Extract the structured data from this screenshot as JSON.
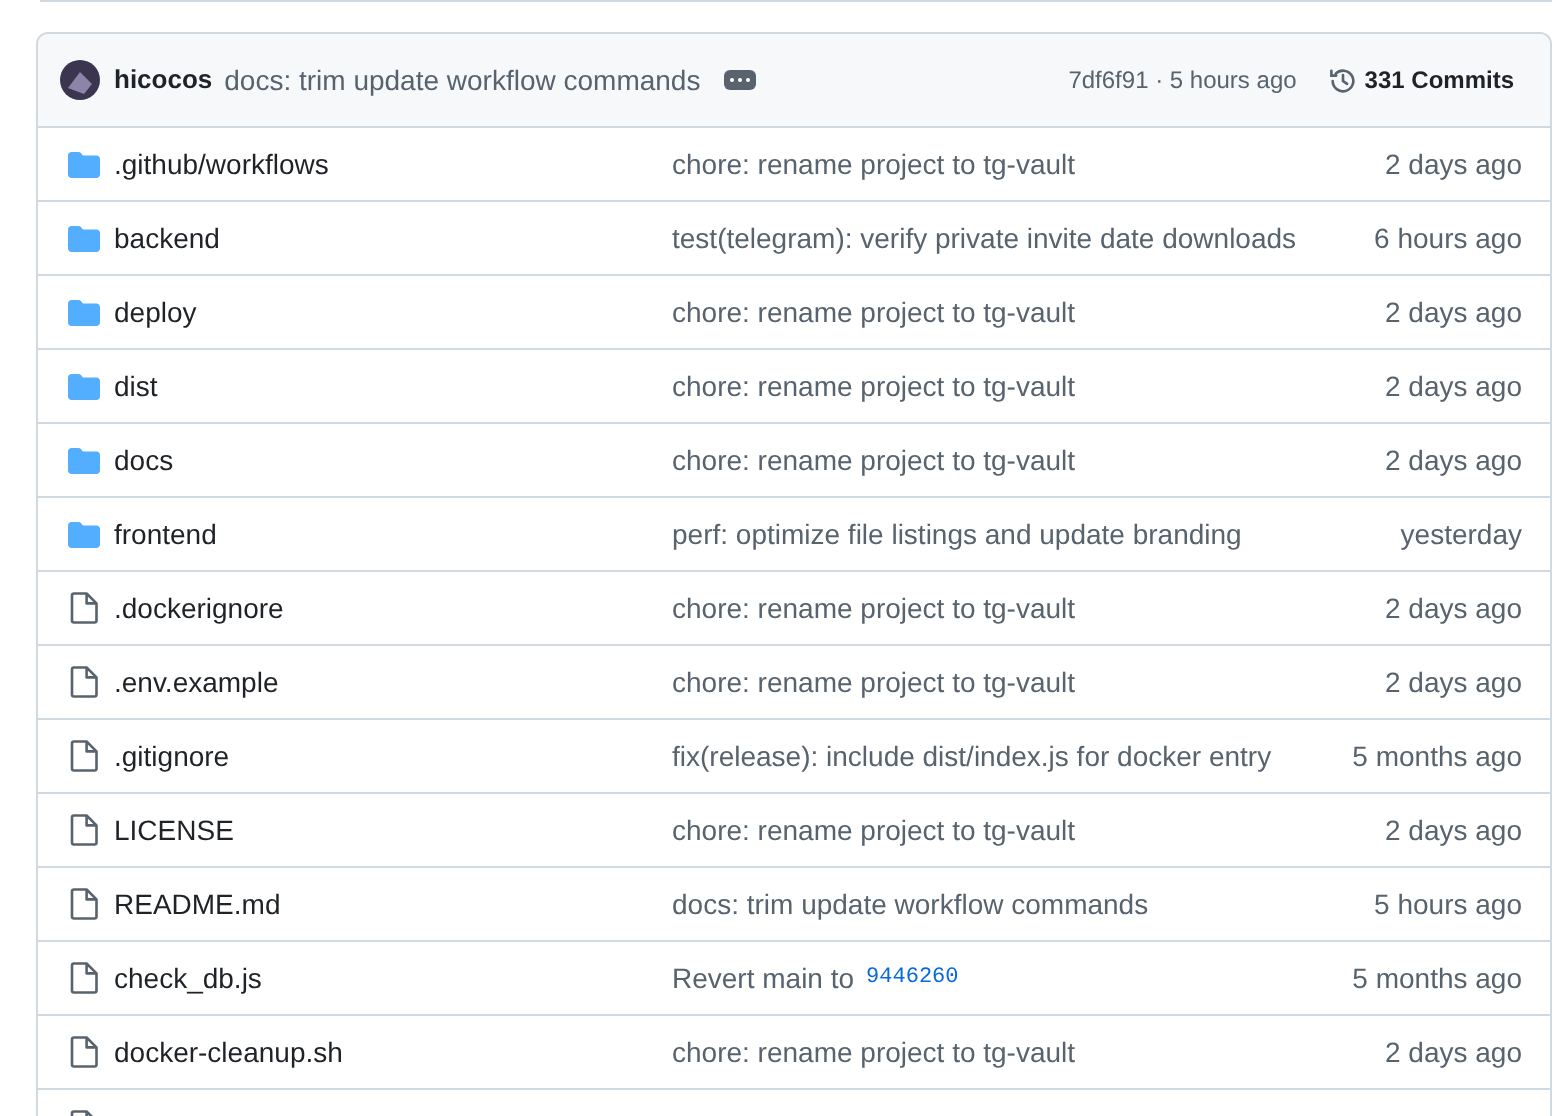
{
  "latest_commit": {
    "author": "hicocos",
    "message": "docs: trim update workflow commands",
    "sha_time": "7df6f91 · 5 hours ago",
    "commits": "331 Commits"
  },
  "rows": [
    {
      "kind": "folder",
      "name": ".github/workflows",
      "message": "chore: rename project to tg-vault",
      "time": "2 days ago"
    },
    {
      "kind": "folder",
      "name": "backend",
      "message": "test(telegram): verify private invite date downloads",
      "time": "6 hours ago"
    },
    {
      "kind": "folder",
      "name": "deploy",
      "message": "chore: rename project to tg-vault",
      "time": "2 days ago"
    },
    {
      "kind": "folder",
      "name": "dist",
      "message": "chore: rename project to tg-vault",
      "time": "2 days ago"
    },
    {
      "kind": "folder",
      "name": "docs",
      "message": "chore: rename project to tg-vault",
      "time": "2 days ago"
    },
    {
      "kind": "folder",
      "name": "frontend",
      "message": "perf: optimize file listings and update branding",
      "time": "yesterday"
    },
    {
      "kind": "file",
      "name": ".dockerignore",
      "message": "chore: rename project to tg-vault",
      "time": "2 days ago"
    },
    {
      "kind": "file",
      "name": ".env.example",
      "message": "chore: rename project to tg-vault",
      "time": "2 days ago"
    },
    {
      "kind": "file",
      "name": ".gitignore",
      "message": "fix(release): include dist/index.js for docker entry",
      "time": "5 months ago"
    },
    {
      "kind": "file",
      "name": "LICENSE",
      "message": "chore: rename project to tg-vault",
      "time": "2 days ago"
    },
    {
      "kind": "file",
      "name": "README.md",
      "message": "docs: trim update workflow commands",
      "time": "5 hours ago"
    },
    {
      "kind": "file",
      "name": "check_db.js",
      "message": "Revert main to",
      "sha": "9446260",
      "time": "5 months ago"
    },
    {
      "kind": "file",
      "name": "docker-cleanup.sh",
      "message": "chore: rename project to tg-vault",
      "time": "2 days ago"
    },
    {
      "kind": "file"
    }
  ]
}
